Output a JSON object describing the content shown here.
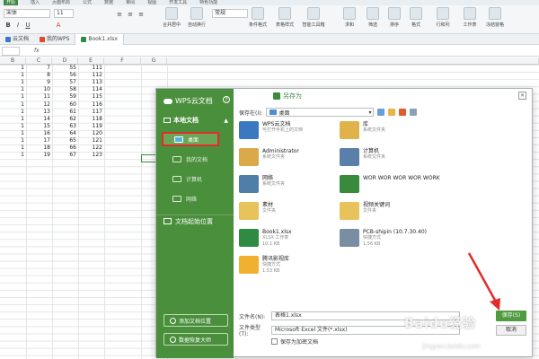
{
  "menubar": {
    "items": [
      "开始",
      "插入",
      "页面布局",
      "公式",
      "数据",
      "审阅",
      "视图",
      "开发工具",
      "特色功能"
    ]
  },
  "ribbon": {
    "font_name": "宋体",
    "font_size": "11",
    "number_format": "常规",
    "tools": [
      "合并居中",
      "自动换行",
      "条件格式",
      "表格样式",
      "智能工具箱",
      "求和",
      "筛选",
      "排序",
      "格式",
      "行和列",
      "工作表",
      "冻结窗格"
    ]
  },
  "tabs": [
    {
      "label": "云文档",
      "active": false
    },
    {
      "label": "我的WPS",
      "active": false
    },
    {
      "label": "Book1.xlsx",
      "active": true
    }
  ],
  "formula": {
    "fx": "fx"
  },
  "grid": {
    "columns": [
      "B",
      "C",
      "D",
      "E",
      "F",
      "G"
    ],
    "rows": [
      [
        "1",
        "7",
        "55",
        "111"
      ],
      [
        "1",
        "8",
        "56",
        "112"
      ],
      [
        "1",
        "9",
        "57",
        "113"
      ],
      [
        "1",
        "10",
        "58",
        "114"
      ],
      [
        "1",
        "11",
        "59",
        "115"
      ],
      [
        "1",
        "12",
        "60",
        "116"
      ],
      [
        "1",
        "13",
        "61",
        "117"
      ],
      [
        "1",
        "14",
        "62",
        "118"
      ],
      [
        "1",
        "15",
        "63",
        "119"
      ],
      [
        "1",
        "16",
        "64",
        "120"
      ],
      [
        "1",
        "17",
        "65",
        "121"
      ],
      [
        "1",
        "18",
        "66",
        "122"
      ],
      [
        "1",
        "19",
        "67",
        "123"
      ]
    ]
  },
  "dialog": {
    "title": "另存为",
    "brand": "WPS云文档",
    "help": "?",
    "section": "本地文档",
    "nav": [
      {
        "label": "桌面",
        "selected": true
      },
      {
        "label": "我的文档",
        "selected": false
      },
      {
        "label": "计算机",
        "selected": false
      },
      {
        "label": "网络",
        "selected": false
      }
    ],
    "start_location": "文档起始位置",
    "add_location": "添加文档位置",
    "recovery": "数据恢复大师",
    "save_in_label": "保存在(I):",
    "save_in_value": "桌面",
    "files": [
      {
        "name": "WPS云文档",
        "sub": "可打开手机上的文档",
        "icon": "cloud-icon",
        "color": "#3a78c2"
      },
      {
        "name": "库",
        "sub": "系统文件夹",
        "icon": "library-icon",
        "color": "#e0b24a"
      },
      {
        "name": "Administrator",
        "sub": "系统文件夹",
        "icon": "user-folder-icon",
        "color": "#d9a94a"
      },
      {
        "name": "计算机",
        "sub": "系统文件夹",
        "icon": "computer-icon",
        "color": "#5a7fa8"
      },
      {
        "name": "网络",
        "sub": "系统文件夹",
        "icon": "network-icon",
        "color": "#4f7fa8"
      },
      {
        "name": "WOR WOR WOR WOR WORK",
        "sub": "",
        "icon": "document-icon",
        "color": "#3a8a3d"
      },
      {
        "name": "素材",
        "sub": "文件夹",
        "icon": "folder-icon",
        "color": "#e8c25a"
      },
      {
        "name": "视频关键词",
        "sub": "文件夹",
        "icon": "folder-icon",
        "color": "#e8c25a"
      },
      {
        "name": "Book1.xlsx",
        "sub": "XLSX 工作表\n10.1 KB",
        "icon": "excel-file-icon",
        "color": "#2f8a44"
      },
      {
        "name": "PCB-shipin (10.7.30.40)",
        "sub": "快捷方式\n1.56 KB",
        "icon": "shortcut-icon",
        "color": "#7a8ea3"
      },
      {
        "name": "腾讯影视库",
        "sub": "快捷方式\n1.53 KB",
        "icon": "video-shortcut-icon",
        "color": "#f0b030"
      }
    ],
    "filename_label": "文件名(N):",
    "filename_value": "表格1.xlsx",
    "filetype_label": "文件类型(T):",
    "filetype_value": "Microsoft Excel 文件(*.xlsx)",
    "encrypt_label": "保存为加密文档",
    "save_label": "保存(S)",
    "cancel_label": "取消"
  },
  "watermark": {
    "text": "Baidu经验",
    "url": "jingyan.baidu.com"
  },
  "colors": {
    "accent_green": "#4a8f3c",
    "highlight_red": "#e32b2b",
    "arrow_red": "#e32b2b"
  }
}
